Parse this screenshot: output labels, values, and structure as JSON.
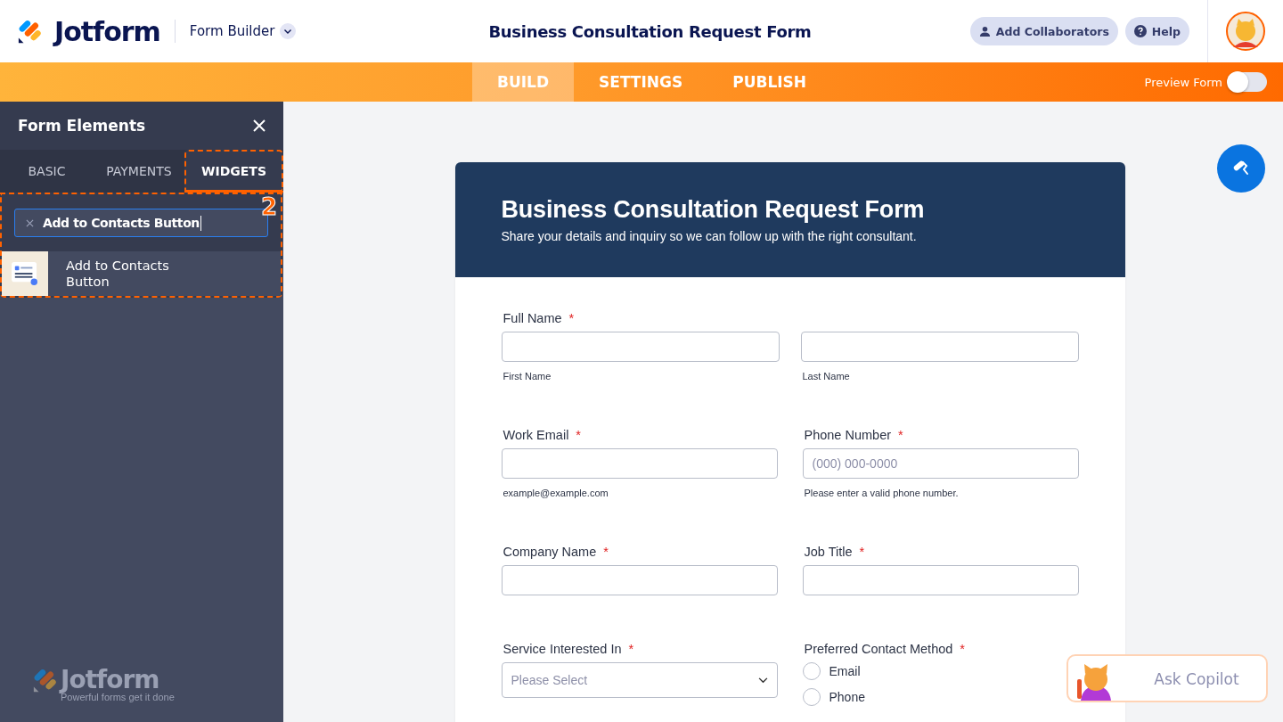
{
  "header": {
    "logo": "Jotform",
    "product": "Form Builder",
    "title": "Business Consultation Request Form",
    "buttons": [
      {
        "label": "Add Collaborators",
        "kind": "user"
      },
      {
        "label": "Help",
        "kind": "help"
      }
    ]
  },
  "nav": {
    "tabs": [
      {
        "label": "BUILD",
        "selected": true
      },
      {
        "label": "SETTINGS",
        "selected": false
      },
      {
        "label": "PUBLISH",
        "selected": false
      }
    ],
    "preview": {
      "label": "Preview Form",
      "on": false
    }
  },
  "sidebar": {
    "title": "Form Elements",
    "tabs": [
      {
        "label": "BASIC",
        "selected": false
      },
      {
        "label": "PAYMENTS",
        "selected": false
      },
      {
        "label": "WIDGETS",
        "selected": true
      }
    ],
    "step": "2",
    "search": {
      "value": "Add to Contacts Button"
    },
    "results": [
      {
        "label": "Add to Contacts Button"
      }
    ],
    "footer": {
      "logo": "Jotform",
      "tagline": "Powerful forms get it done"
    }
  },
  "form": {
    "title": "Business Consultation Request Form",
    "subtitle": "Share your details and inquiry so we can follow up with the right consultant.",
    "fields": [
      {
        "kind": "split",
        "label": "Full Name",
        "required_mark": "*",
        "parts": [
          {
            "sublabel": "First Name"
          },
          {
            "sublabel": "Last Name"
          }
        ]
      },
      {
        "kind": "text",
        "label": "Work Email",
        "required_mark": "*",
        "sublabel": "example@example.com"
      },
      {
        "kind": "text",
        "label": "Phone Number",
        "required_mark": "*",
        "placeholder": "(000) 000-0000",
        "sublabel": "Please enter a valid phone number."
      },
      {
        "kind": "text",
        "label": "Company Name",
        "required_mark": "*"
      },
      {
        "kind": "text",
        "label": "Job Title",
        "required_mark": "*"
      },
      {
        "kind": "select",
        "label": "Service Interested In",
        "required_mark": "*",
        "placeholder": "Please Select"
      },
      {
        "kind": "radio",
        "label": "Preferred Contact Method",
        "required_mark": "*",
        "options": [
          {
            "label": "Email",
            "selected": false
          },
          {
            "label": "Phone",
            "selected": false
          }
        ]
      }
    ]
  },
  "copilot": {
    "label": "Ask Copilot"
  }
}
